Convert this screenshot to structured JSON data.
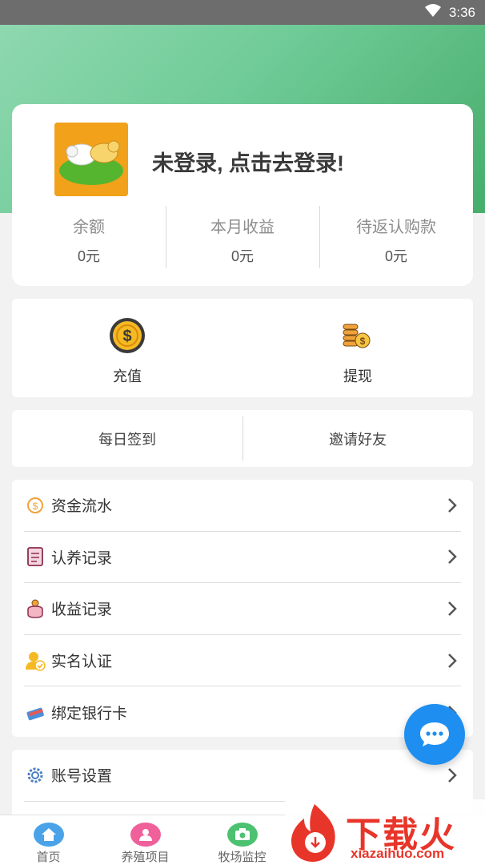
{
  "status_bar": {
    "time": "3:36"
  },
  "profile": {
    "login_prompt": "未登录, 点击去登录!",
    "stats": [
      {
        "label": "余额",
        "value": "0元"
      },
      {
        "label": "本月收益",
        "value": "0元"
      },
      {
        "label": "待返认购款",
        "value": "0元"
      }
    ]
  },
  "actions": [
    {
      "label": "充值",
      "icon": "coin-icon"
    },
    {
      "label": "提现",
      "icon": "coin-stack-icon"
    }
  ],
  "quick_links": [
    {
      "label": "每日签到"
    },
    {
      "label": "邀请好友"
    }
  ],
  "menu": [
    {
      "label": "资金流水",
      "icon": "money-flow-icon"
    },
    {
      "label": "认养记录",
      "icon": "clipboard-icon"
    },
    {
      "label": "收益记录",
      "icon": "purse-icon"
    },
    {
      "label": "实名认证",
      "icon": "verified-user-icon"
    },
    {
      "label": "绑定银行卡",
      "icon": "bank-card-icon"
    }
  ],
  "menu2": [
    {
      "label": "账号设置",
      "icon": "gear-icon"
    }
  ],
  "tabbar": [
    {
      "label": "首页",
      "icon": "home-icon",
      "color": "#4aa3e8"
    },
    {
      "label": "养殖项目",
      "icon": "user-group-icon",
      "color": "#f0609a"
    },
    {
      "label": "牧场监控",
      "icon": "camera-icon",
      "color": "#4cc170"
    }
  ],
  "watermark": {
    "title": "下载火",
    "subtitle": "xiazaihuo.com"
  },
  "colors": {
    "accent_green": "#6fcb97",
    "fab_blue": "#1e8ff0",
    "watermark_red": "#e8352a"
  }
}
